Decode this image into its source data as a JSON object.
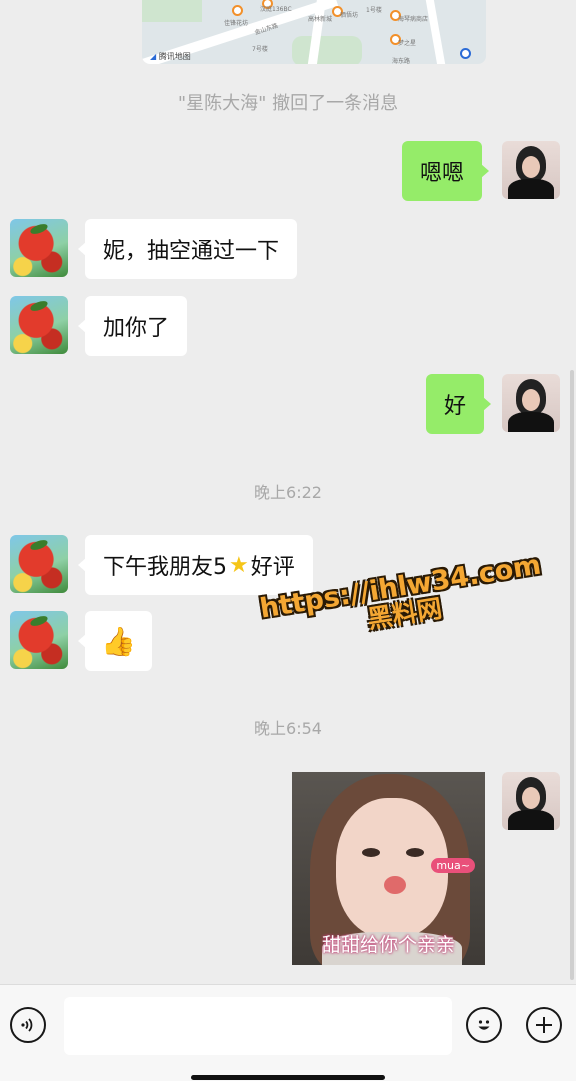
{
  "map": {
    "provider_label": "腾讯地图",
    "labels": [
      "佳锋花坊",
      "金山东路",
      "汉庭136BC",
      "高林新城",
      "栖悟坊",
      "海琴病商店",
      "梦之星",
      "海东路",
      "7号楼",
      "1号楼"
    ]
  },
  "messages": {
    "recall_notice": "\"星陈大海\" 撤回了一条消息",
    "msg_1": "嗯嗯",
    "msg_2": "妮，抽空通过一下",
    "msg_3": "加你了",
    "msg_4": "好",
    "time_1": "晚上6:22",
    "msg_5_before": "下午我朋友5",
    "msg_5_icon": "star-icon",
    "msg_5_after": "好评",
    "msg_6_icon": "thumbs-up-icon",
    "time_2": "晚上6:54",
    "photo_tag": "mua~",
    "photo_caption": "甜甜给你个亲亲"
  },
  "watermark": {
    "url": "https://ihlw34.com",
    "name": "黑料网"
  },
  "input_bar": {
    "voice_icon": "voice-icon",
    "emoji_icon": "emoji-icon",
    "plus_icon": "plus-icon"
  },
  "colors": {
    "background": "#ededed",
    "sent_bubble": "#95ec69",
    "received_bubble": "#ffffff",
    "watermark": "#f4a733"
  }
}
